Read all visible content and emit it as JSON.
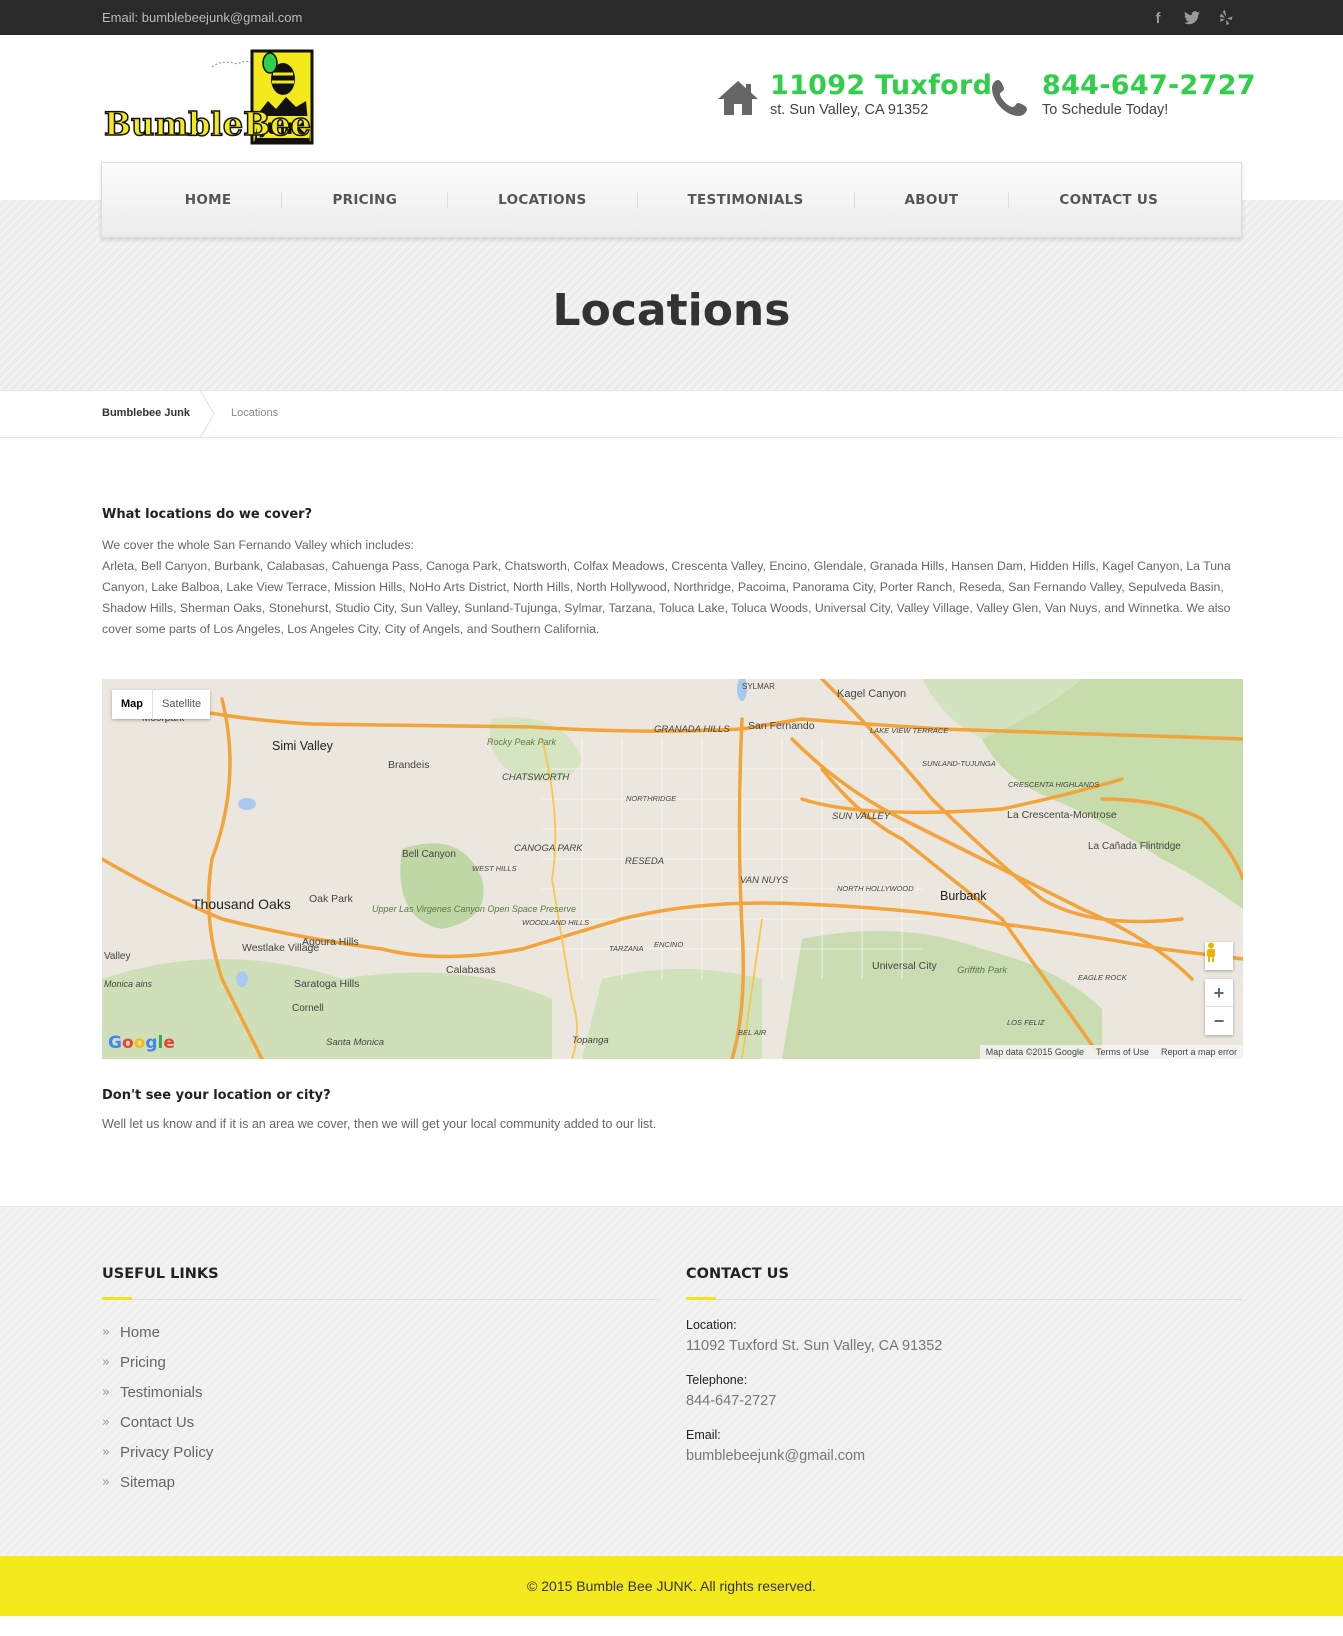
{
  "topbar": {
    "email": "Email: bumblebeejunk@gmail.com",
    "social": [
      {
        "icon": "facebook-icon",
        "glyph": "f"
      },
      {
        "icon": "twitter-icon",
        "glyph": "🐦"
      },
      {
        "icon": "yelp-icon",
        "glyph": "✱"
      }
    ]
  },
  "header": {
    "logo_text": "BumbleBee",
    "logo_junk": "JUNK",
    "address_line1": "11092 Tuxford",
    "address_line2": "st. Sun Valley, CA 91352",
    "phone": "844-647-2727",
    "phone_sub": "To Schedule Today!"
  },
  "nav": [
    "HOME",
    "PRICING",
    "LOCATIONS",
    "TESTIMONIALS",
    "ABOUT",
    "CONTACT US"
  ],
  "page_title": "Locations",
  "breadcrumb": {
    "home": "Bumblebee Junk",
    "current": "Locations"
  },
  "content": {
    "heading": "What locations do we cover?",
    "intro_line1": "We cover the whole San Fernando Valley which includes:",
    "intro_body": "Arleta, Bell Canyon, Burbank, Calabasas, Cahuenga Pass, Canoga Park, Chatsworth, Colfax Meadows, Crescenta Valley, Encino, Glendale, Granada Hills, Hansen Dam, Hidden Hills, Kagel Canyon, La Tuna Canyon, Lake Balboa, Lake View Terrace, Mission Hills, NoHo Arts District, North Hills, North Hollywood, Northridge, Pacoima, Panorama City, Porter Ranch, Reseda, San Fernando Valley, Sepulveda Basin, Shadow Hills, Sherman Oaks, Stonehurst, Studio City, Sun Valley, Sunland-Tujunga, Sylmar, Tarzana, Toluca Lake, Toluca Woods, Universal City, Valley Village, Valley Glen, Van Nuys, and Winnetka. We also cover some parts of Los Angeles, Los Angeles City, City of Angels, and Southern California.",
    "see_heading": "Don't see your location or city?",
    "see_text": "Well let us know and if it is an area we cover, then we will get your local community added to our list."
  },
  "map": {
    "tab_map": "Map",
    "tab_satellite": "Satellite",
    "google": "Google",
    "attrib": [
      "Map data ©2015 Google",
      "Terms of Use",
      "Report a map error"
    ],
    "labels": [
      "SYLMAR",
      "Kagel Canyon",
      "Moorpark",
      "San Fernando",
      "GRANADA HILLS",
      "Simi Valley",
      "Rocky Peak Park",
      "LAKE VIEW TERRACE",
      "Brandeis",
      "CHATSWORTH",
      "SUNLAND-TUJUNGA",
      "CRESCENTA HIGHLANDS",
      "NORTHRIDGE",
      "SUN VALLEY",
      "La Crescenta-Montrose",
      "La Cañada Flintridge",
      "CANOGA PARK",
      "Bell Canyon",
      "WEST HILLS",
      "RESEDA",
      "VAN NUYS",
      "NORTH HOLLYWOOD",
      "Upper Las Virgenes Canyon Open Space Preserve",
      "Burbank",
      "Thousand Oaks",
      "Oak Park",
      "WOODLAND HILLS",
      "Agoura Hills",
      "Westlake Village",
      "TARZANA",
      "ENCINO",
      "Universal City",
      "Griffith Park",
      "Calabasas",
      "EAGLE ROCK",
      "Saratoga Hills",
      "Cornell",
      "BEL AIR",
      "LOS FELIZ",
      "Santa Monica",
      "Topanga",
      "Valley",
      "Monica ains"
    ]
  },
  "footer": {
    "useful_title": "USEFUL LINKS",
    "links": [
      "Home",
      "Pricing",
      "Testimonials",
      "Contact Us",
      "Privacy Policy",
      "Sitemap"
    ],
    "contact_title": "CONTACT US",
    "location_label": "Location:",
    "location_value": "11092 Tuxford St. Sun Valley, CA 91352",
    "tel_label": "Telephone:",
    "tel_value": "844-647-2727",
    "email_label": "Email:",
    "email_value": "bumblebeejunk@gmail.com",
    "copyright": "© 2015 Bumble Bee JUNK. All rights reserved."
  },
  "colors": {
    "accent_green": "#2fcf4a",
    "accent_yellow": "#f4ea1b",
    "topbar": "#2a2a2a"
  }
}
